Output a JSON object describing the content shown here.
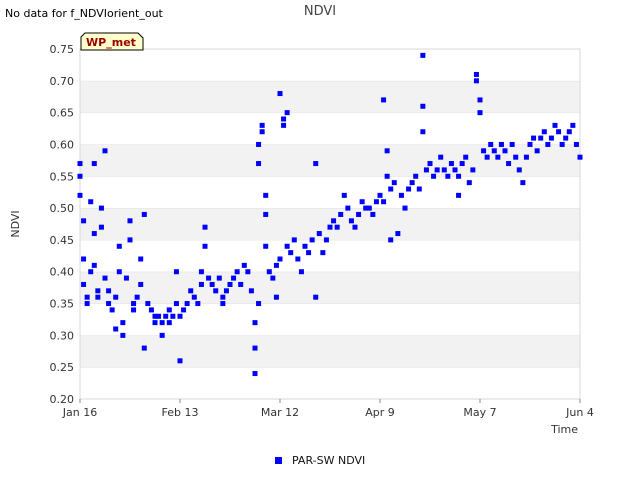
{
  "notice": "No data for f_NDVIorient_out",
  "badge": "WP_met",
  "chart_data": {
    "type": "scatter",
    "title": "NDVI",
    "xlabel": "Time",
    "ylabel": "NDVI",
    "x_start": "2024-01-16",
    "x_end": "2024-06-04",
    "x_ticks": [
      "Jan 16",
      "Feb 13",
      "Mar 12",
      "Apr 9",
      "May 7",
      "Jun 4"
    ],
    "ylim": [
      0.2,
      0.75
    ],
    "y_ticks": [
      "0.20",
      "0.25",
      "0.30",
      "0.35",
      "0.40",
      "0.45",
      "0.50",
      "0.55",
      "0.60",
      "0.65",
      "0.70",
      "0.75"
    ],
    "grid": "horizontal alternating bands",
    "legend_position": "bottom-center",
    "series": [
      {
        "name": "PAR-SW NDVI",
        "color": "#0000ff",
        "points": [
          [
            "2024-01-16",
            0.57
          ],
          [
            "2024-01-16",
            0.55
          ],
          [
            "2024-01-16",
            0.52
          ],
          [
            "2024-01-17",
            0.48
          ],
          [
            "2024-01-17",
            0.42
          ],
          [
            "2024-01-17",
            0.38
          ],
          [
            "2024-01-18",
            0.36
          ],
          [
            "2024-01-18",
            0.35
          ],
          [
            "2024-01-19",
            0.4
          ],
          [
            "2024-01-19",
            0.51
          ],
          [
            "2024-01-20",
            0.57
          ],
          [
            "2024-01-20",
            0.46
          ],
          [
            "2024-01-20",
            0.41
          ],
          [
            "2024-01-21",
            0.37
          ],
          [
            "2024-01-21",
            0.36
          ],
          [
            "2024-01-22",
            0.5
          ],
          [
            "2024-01-22",
            0.47
          ],
          [
            "2024-01-23",
            0.59
          ],
          [
            "2024-01-23",
            0.39
          ],
          [
            "2024-01-24",
            0.37
          ],
          [
            "2024-01-24",
            0.35
          ],
          [
            "2024-01-25",
            0.34
          ],
          [
            "2024-01-26",
            0.31
          ],
          [
            "2024-01-26",
            0.36
          ],
          [
            "2024-01-27",
            0.44
          ],
          [
            "2024-01-27",
            0.4
          ],
          [
            "2024-01-28",
            0.3
          ],
          [
            "2024-01-28",
            0.32
          ],
          [
            "2024-01-29",
            0.39
          ],
          [
            "2024-01-30",
            0.48
          ],
          [
            "2024-01-30",
            0.45
          ],
          [
            "2024-01-31",
            0.35
          ],
          [
            "2024-01-31",
            0.34
          ],
          [
            "2024-02-01",
            0.36
          ],
          [
            "2024-02-02",
            0.42
          ],
          [
            "2024-02-02",
            0.38
          ],
          [
            "2024-02-03",
            0.49
          ],
          [
            "2024-02-03",
            0.28
          ],
          [
            "2024-02-04",
            0.35
          ],
          [
            "2024-02-05",
            0.34
          ],
          [
            "2024-02-06",
            0.33
          ],
          [
            "2024-02-06",
            0.32
          ],
          [
            "2024-02-07",
            0.33
          ],
          [
            "2024-02-08",
            0.32
          ],
          [
            "2024-02-08",
            0.3
          ],
          [
            "2024-02-09",
            0.33
          ],
          [
            "2024-02-10",
            0.32
          ],
          [
            "2024-02-10",
            0.34
          ],
          [
            "2024-02-11",
            0.33
          ],
          [
            "2024-02-12",
            0.4
          ],
          [
            "2024-02-12",
            0.35
          ],
          [
            "2024-02-13",
            0.26
          ],
          [
            "2024-02-13",
            0.33
          ],
          [
            "2024-02-14",
            0.34
          ],
          [
            "2024-02-15",
            0.35
          ],
          [
            "2024-02-16",
            0.37
          ],
          [
            "2024-02-17",
            0.36
          ],
          [
            "2024-02-18",
            0.35
          ],
          [
            "2024-02-19",
            0.38
          ],
          [
            "2024-02-19",
            0.4
          ],
          [
            "2024-02-20",
            0.47
          ],
          [
            "2024-02-20",
            0.44
          ],
          [
            "2024-02-21",
            0.39
          ],
          [
            "2024-02-22",
            0.38
          ],
          [
            "2024-02-23",
            0.37
          ],
          [
            "2024-02-24",
            0.39
          ],
          [
            "2024-02-25",
            0.36
          ],
          [
            "2024-02-25",
            0.35
          ],
          [
            "2024-02-26",
            0.37
          ],
          [
            "2024-02-27",
            0.38
          ],
          [
            "2024-02-28",
            0.39
          ],
          [
            "2024-02-29",
            0.4
          ],
          [
            "2024-03-01",
            0.38
          ],
          [
            "2024-03-02",
            0.41
          ],
          [
            "2024-03-03",
            0.4
          ],
          [
            "2024-03-04",
            0.37
          ],
          [
            "2024-03-05",
            0.32
          ],
          [
            "2024-03-05",
            0.28
          ],
          [
            "2024-03-05",
            0.24
          ],
          [
            "2024-03-06",
            0.35
          ],
          [
            "2024-03-06",
            0.6
          ],
          [
            "2024-03-06",
            0.57
          ],
          [
            "2024-03-07",
            0.63
          ],
          [
            "2024-03-07",
            0.62
          ],
          [
            "2024-03-08",
            0.52
          ],
          [
            "2024-03-08",
            0.49
          ],
          [
            "2024-03-08",
            0.44
          ],
          [
            "2024-03-09",
            0.4
          ],
          [
            "2024-03-10",
            0.39
          ],
          [
            "2024-03-11",
            0.41
          ],
          [
            "2024-03-11",
            0.36
          ],
          [
            "2024-03-12",
            0.42
          ],
          [
            "2024-03-12",
            0.68
          ],
          [
            "2024-03-13",
            0.64
          ],
          [
            "2024-03-13",
            0.63
          ],
          [
            "2024-03-14",
            0.65
          ],
          [
            "2024-03-14",
            0.44
          ],
          [
            "2024-03-15",
            0.43
          ],
          [
            "2024-03-16",
            0.45
          ],
          [
            "2024-03-17",
            0.42
          ],
          [
            "2024-03-18",
            0.4
          ],
          [
            "2024-03-19",
            0.44
          ],
          [
            "2024-03-20",
            0.43
          ],
          [
            "2024-03-21",
            0.45
          ],
          [
            "2024-03-22",
            0.57
          ],
          [
            "2024-03-22",
            0.36
          ],
          [
            "2024-03-23",
            0.46
          ],
          [
            "2024-03-24",
            0.43
          ],
          [
            "2024-03-25",
            0.45
          ],
          [
            "2024-03-26",
            0.47
          ],
          [
            "2024-03-27",
            0.48
          ],
          [
            "2024-03-28",
            0.47
          ],
          [
            "2024-03-29",
            0.49
          ],
          [
            "2024-03-30",
            0.52
          ],
          [
            "2024-03-31",
            0.5
          ],
          [
            "2024-04-01",
            0.48
          ],
          [
            "2024-04-02",
            0.47
          ],
          [
            "2024-04-03",
            0.49
          ],
          [
            "2024-04-04",
            0.51
          ],
          [
            "2024-04-05",
            0.5
          ],
          [
            "2024-04-06",
            0.5
          ],
          [
            "2024-04-07",
            0.49
          ],
          [
            "2024-04-08",
            0.51
          ],
          [
            "2024-04-09",
            0.52
          ],
          [
            "2024-04-10",
            0.51
          ],
          [
            "2024-04-10",
            0.67
          ],
          [
            "2024-04-11",
            0.59
          ],
          [
            "2024-04-11",
            0.55
          ],
          [
            "2024-04-12",
            0.45
          ],
          [
            "2024-04-12",
            0.53
          ],
          [
            "2024-04-13",
            0.54
          ],
          [
            "2024-04-14",
            0.46
          ],
          [
            "2024-04-15",
            0.52
          ],
          [
            "2024-04-16",
            0.5
          ],
          [
            "2024-04-17",
            0.53
          ],
          [
            "2024-04-18",
            0.54
          ],
          [
            "2024-04-19",
            0.55
          ],
          [
            "2024-04-20",
            0.53
          ],
          [
            "2024-04-21",
            0.74
          ],
          [
            "2024-04-21",
            0.66
          ],
          [
            "2024-04-21",
            0.62
          ],
          [
            "2024-04-22",
            0.56
          ],
          [
            "2024-04-23",
            0.57
          ],
          [
            "2024-04-24",
            0.55
          ],
          [
            "2024-04-25",
            0.56
          ],
          [
            "2024-04-26",
            0.58
          ],
          [
            "2024-04-27",
            0.56
          ],
          [
            "2024-04-28",
            0.55
          ],
          [
            "2024-04-29",
            0.57
          ],
          [
            "2024-04-30",
            0.56
          ],
          [
            "2024-05-01",
            0.52
          ],
          [
            "2024-05-01",
            0.55
          ],
          [
            "2024-05-02",
            0.57
          ],
          [
            "2024-05-03",
            0.58
          ],
          [
            "2024-05-04",
            0.54
          ],
          [
            "2024-05-05",
            0.56
          ],
          [
            "2024-05-06",
            0.71
          ],
          [
            "2024-05-06",
            0.7
          ],
          [
            "2024-05-07",
            0.67
          ],
          [
            "2024-05-07",
            0.65
          ],
          [
            "2024-05-08",
            0.59
          ],
          [
            "2024-05-09",
            0.58
          ],
          [
            "2024-05-10",
            0.6
          ],
          [
            "2024-05-11",
            0.59
          ],
          [
            "2024-05-12",
            0.58
          ],
          [
            "2024-05-13",
            0.6
          ],
          [
            "2024-05-14",
            0.59
          ],
          [
            "2024-05-15",
            0.57
          ],
          [
            "2024-05-16",
            0.6
          ],
          [
            "2024-05-17",
            0.58
          ],
          [
            "2024-05-18",
            0.56
          ],
          [
            "2024-05-19",
            0.54
          ],
          [
            "2024-05-20",
            0.58
          ],
          [
            "2024-05-21",
            0.6
          ],
          [
            "2024-05-22",
            0.61
          ],
          [
            "2024-05-23",
            0.59
          ],
          [
            "2024-05-24",
            0.61
          ],
          [
            "2024-05-25",
            0.62
          ],
          [
            "2024-05-26",
            0.6
          ],
          [
            "2024-05-27",
            0.61
          ],
          [
            "2024-05-28",
            0.63
          ],
          [
            "2024-05-29",
            0.62
          ],
          [
            "2024-05-30",
            0.6
          ],
          [
            "2024-05-31",
            0.61
          ],
          [
            "2024-06-01",
            0.62
          ],
          [
            "2024-06-02",
            0.63
          ],
          [
            "2024-06-03",
            0.6
          ],
          [
            "2024-06-04",
            0.58
          ]
        ]
      }
    ]
  }
}
